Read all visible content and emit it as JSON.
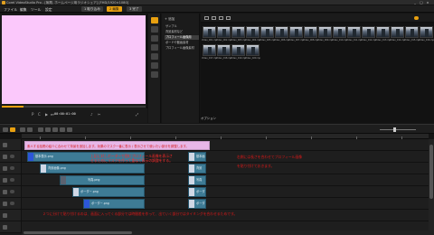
{
  "window": {
    "title": "Corel VideoStudio Pro - [無題, ホームページ用ラジオシェア] [FHD/1920×1080]",
    "controls": [
      "_",
      "□",
      "×"
    ]
  },
  "menubar": {
    "items": [
      "ファイル",
      "編集",
      "ツール",
      "設定"
    ],
    "steps": [
      {
        "label": "1 取り込み",
        "active": false
      },
      {
        "label": "2 編集",
        "active": true
      },
      {
        "label": "3 完了",
        "active": false
      }
    ]
  },
  "preview": {
    "timecode": "00:00:01:00",
    "screen_color": "#fbc8fb",
    "progress": 0.15
  },
  "library": {
    "add_label": "+ 追加",
    "folders": [
      {
        "label": "サンプル",
        "active": false
      },
      {
        "label": "背景素材など",
        "active": false
      },
      {
        "label": "プロフィール画像用",
        "active": true
      },
      {
        "label": "ボードや動画素材",
        "active": false
      },
      {
        "label": "プロフィール画像素材",
        "active": false
      }
    ],
    "thumbnails": [
      "Video_001.mp4",
      "Video_002.mp4",
      "Video_003.mp4",
      "Video_004.mp4",
      "Video_005.mp4",
      "Video_006.mp4",
      "Video_007.mp4",
      "Video_008.mp4",
      "Video_009.mp4",
      "Video_010.mp4",
      "Video_011.mp4",
      "Video_012.mp4",
      "Video_013.mp4",
      "Video_014.mp4",
      "Video_015.mp4",
      "Video_016.mp4",
      "Video_017.mp4",
      "Video_018.mp4",
      "Video_019.mp4",
      "Video_020.mp4"
    ],
    "options_label": "オプション"
  },
  "timeline": {
    "title_clip": "素人する話題の紹介に合わせて背景を追加します。効果のマスク一番に表示 / 表示させて使いたい部分を調整します。",
    "tracks": [
      {
        "clip": "基本表示.png",
        "end_clip": "基本画"
      },
      {
        "clip": "背景画像.png",
        "end_clip": "背景"
      },
      {
        "clip": "写真.png",
        "end_clip": "写真"
      },
      {
        "clip": "ボーダー.png",
        "end_clip": "ボーダ"
      },
      {
        "clip": "ボーダー.png",
        "end_clip": "ボーダ"
      }
    ],
    "annotations": {
      "overlay_left": "上記に対しボーダーで囲むプロフィール画像を表示させるためにマスクを作って重ねて表示の調整をする。",
      "overlay_right_1": "右側には長さを合わせてプロフィール画像",
      "overlay_right_2": "を貼り付けておきます。",
      "bottom": "２つに分けて貼り付けるのは、画面に入ってくる部分では時間差を作って、出ていく部分ではタイミングを合わせるためです。"
    }
  }
}
